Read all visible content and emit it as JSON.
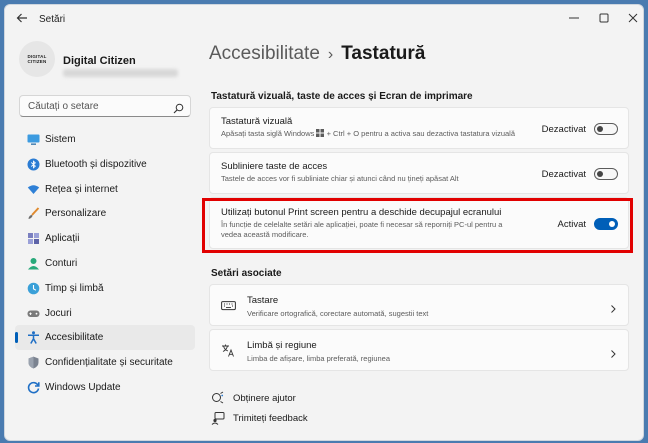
{
  "window": {
    "title": "Setări",
    "controls": [
      "minimize-icon",
      "maximize-icon",
      "close-icon"
    ]
  },
  "profile": {
    "avatar_line1": "DIGITAL",
    "avatar_line2": "CITIZEN",
    "name": "Digital Citizen"
  },
  "search": {
    "placeholder": "Căutați o setare"
  },
  "sidebar": {
    "items": [
      {
        "label": "Sistem",
        "icon": "monitor-icon"
      },
      {
        "label": "Bluetooth și dispozitive",
        "icon": "bluetooth-icon"
      },
      {
        "label": "Rețea și internet",
        "icon": "wifi-icon"
      },
      {
        "label": "Personalizare",
        "icon": "brush-icon"
      },
      {
        "label": "Aplicații",
        "icon": "apps-icon"
      },
      {
        "label": "Conturi",
        "icon": "account-icon"
      },
      {
        "label": "Timp și limbă",
        "icon": "globe-clock-icon"
      },
      {
        "label": "Jocuri",
        "icon": "gamepad-icon"
      },
      {
        "label": "Accesibilitate",
        "icon": "accessibility-icon",
        "active": true
      },
      {
        "label": "Confidențialitate și securitate",
        "icon": "shield-icon"
      },
      {
        "label": "Windows Update",
        "icon": "update-icon"
      }
    ]
  },
  "breadcrumb": {
    "parent": "Accesibilitate",
    "separator": "›",
    "current": "Tastatură"
  },
  "section1": {
    "title": "Tastatură vizuală, taste de acces și Ecran de imprimare",
    "cards": [
      {
        "title": "Tastatură vizuală",
        "desc_before": "Apăsați tasta siglă Windows",
        "desc_after": "+ Ctrl + O pentru a activa sau dezactiva tastatura vizuală",
        "state": "Dezactivat",
        "on": false
      },
      {
        "title": "Subliniere taste de acces",
        "desc": "Tastele de acces vor fi subliniate chiar și atunci când nu țineți apăsat Alt",
        "state": "Dezactivat",
        "on": false
      },
      {
        "title": "Utilizați butonul Print screen pentru a deschide decupajul ecranului",
        "desc_line1": "În funcție de celelalte setări ale aplicației, poate fi necesar să reporniți PC-ul pentru a",
        "desc_line2": "vedea această modificare.",
        "state": "Activat",
        "on": true
      }
    ]
  },
  "section2": {
    "title": "Setări asociate",
    "items": [
      {
        "title": "Tastare",
        "desc": "Verificare ortografică, corectare automată, sugestii text",
        "icon": "keyboard-icon"
      },
      {
        "title": "Limbă și regiune",
        "desc": "Limba de afișare, limba preferată, regiunea",
        "icon": "language-icon"
      }
    ]
  },
  "links": [
    {
      "label": "Obținere ajutor",
      "icon": "help-icon"
    },
    {
      "label": "Trimiteți feedback",
      "icon": "feedback-icon"
    }
  ],
  "colors": {
    "accent": "#005fb8",
    "highlight": "#e10000"
  }
}
